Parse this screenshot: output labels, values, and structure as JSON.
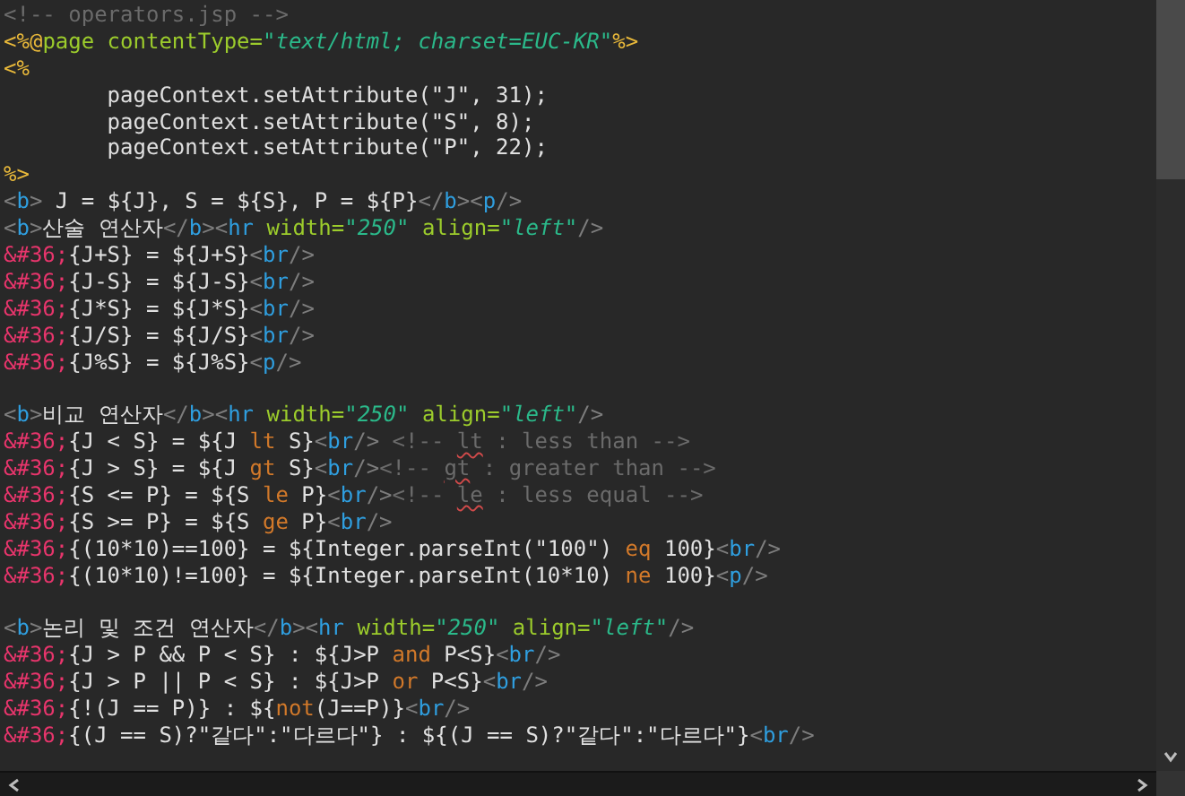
{
  "editor": {
    "lines": [
      {
        "kind": "code",
        "tokens": [
          {
            "kind": "comment",
            "text": "<!-- operators.jsp -->"
          }
        ]
      },
      {
        "kind": "code",
        "tokens": [
          {
            "kind": "directive",
            "text": "<%@"
          },
          {
            "kind": "attr",
            "text": "page contentType="
          },
          {
            "kind": "string",
            "text": "\"text/html; charset=EUC-KR\""
          },
          {
            "kind": "directive",
            "text": "%>"
          }
        ]
      },
      {
        "kind": "code",
        "tokens": [
          {
            "kind": "directive",
            "text": "<%"
          }
        ]
      },
      {
        "kind": "code",
        "tokens": [
          {
            "kind": "text",
            "text": "        pageContext.setAttribute(\"J\", 31);"
          }
        ]
      },
      {
        "kind": "code",
        "tokens": [
          {
            "kind": "text",
            "text": "        pageContext.setAttribute(\"S\", 8);"
          }
        ]
      },
      {
        "kind": "code",
        "tokens": [
          {
            "kind": "text",
            "text": "        pageContext.setAttribute(\"P\", 22);"
          }
        ]
      },
      {
        "kind": "code",
        "tokens": [
          {
            "kind": "directive",
            "text": "%>"
          }
        ]
      },
      {
        "kind": "code",
        "tokens": [
          {
            "kind": "punct",
            "text": "<"
          },
          {
            "kind": "tag",
            "text": "b"
          },
          {
            "kind": "punct",
            "text": ">"
          },
          {
            "kind": "text",
            "text": " J = ${J}, S = ${S}, P = ${P}"
          },
          {
            "kind": "punct",
            "text": "</"
          },
          {
            "kind": "tag",
            "text": "b"
          },
          {
            "kind": "punct",
            "text": "><"
          },
          {
            "kind": "tag",
            "text": "p"
          },
          {
            "kind": "punct",
            "text": "/>"
          }
        ]
      },
      {
        "kind": "code",
        "tokens": [
          {
            "kind": "punct",
            "text": "<"
          },
          {
            "kind": "tag",
            "text": "b"
          },
          {
            "kind": "punct",
            "text": ">"
          },
          {
            "kind": "text",
            "text": "산술 연산자"
          },
          {
            "kind": "punct",
            "text": "</"
          },
          {
            "kind": "tag",
            "text": "b"
          },
          {
            "kind": "punct",
            "text": "><"
          },
          {
            "kind": "tag",
            "text": "hr"
          },
          {
            "kind": "attr",
            "text": " width="
          },
          {
            "kind": "string",
            "text": "\"250\""
          },
          {
            "kind": "attr",
            "text": " align="
          },
          {
            "kind": "string",
            "text": "\"left\""
          },
          {
            "kind": "punct",
            "text": "/>"
          }
        ]
      },
      {
        "kind": "code",
        "tokens": [
          {
            "kind": "entity",
            "text": "&#36;"
          },
          {
            "kind": "text",
            "text": "{J+S} = ${J+S}"
          },
          {
            "kind": "punct",
            "text": "<"
          },
          {
            "kind": "tag",
            "text": "br"
          },
          {
            "kind": "punct",
            "text": "/>"
          }
        ]
      },
      {
        "kind": "code",
        "tokens": [
          {
            "kind": "entity",
            "text": "&#36;"
          },
          {
            "kind": "text",
            "text": "{J-S} = ${J-S}"
          },
          {
            "kind": "punct",
            "text": "<"
          },
          {
            "kind": "tag",
            "text": "br"
          },
          {
            "kind": "punct",
            "text": "/>"
          }
        ]
      },
      {
        "kind": "code",
        "tokens": [
          {
            "kind": "entity",
            "text": "&#36;"
          },
          {
            "kind": "text",
            "text": "{J*S} = ${J*S}"
          },
          {
            "kind": "punct",
            "text": "<"
          },
          {
            "kind": "tag",
            "text": "br"
          },
          {
            "kind": "punct",
            "text": "/>"
          }
        ]
      },
      {
        "kind": "code",
        "tokens": [
          {
            "kind": "entity",
            "text": "&#36;"
          },
          {
            "kind": "text",
            "text": "{J/S} = ${J/S}"
          },
          {
            "kind": "punct",
            "text": "<"
          },
          {
            "kind": "tag",
            "text": "br"
          },
          {
            "kind": "punct",
            "text": "/>"
          }
        ]
      },
      {
        "kind": "code",
        "tokens": [
          {
            "kind": "entity",
            "text": "&#36;"
          },
          {
            "kind": "text",
            "text": "{J%S} = ${J%S}"
          },
          {
            "kind": "punct",
            "text": "<"
          },
          {
            "kind": "tag",
            "text": "p"
          },
          {
            "kind": "punct",
            "text": "/>"
          }
        ]
      },
      {
        "kind": "blank"
      },
      {
        "kind": "code",
        "tokens": [
          {
            "kind": "punct",
            "text": "<"
          },
          {
            "kind": "tag",
            "text": "b"
          },
          {
            "kind": "punct",
            "text": ">"
          },
          {
            "kind": "text",
            "text": "비교 연산자"
          },
          {
            "kind": "punct",
            "text": "</"
          },
          {
            "kind": "tag",
            "text": "b"
          },
          {
            "kind": "punct",
            "text": "><"
          },
          {
            "kind": "tag",
            "text": "hr"
          },
          {
            "kind": "attr",
            "text": " width="
          },
          {
            "kind": "string",
            "text": "\"250\""
          },
          {
            "kind": "attr",
            "text": " align="
          },
          {
            "kind": "string",
            "text": "\"left\""
          },
          {
            "kind": "punct",
            "text": "/>"
          }
        ]
      },
      {
        "kind": "code",
        "tokens": [
          {
            "kind": "entity",
            "text": "&#36;"
          },
          {
            "kind": "text",
            "text": "{J < S} = ${J "
          },
          {
            "kind": "keyword",
            "text": "lt"
          },
          {
            "kind": "text",
            "text": " S}"
          },
          {
            "kind": "punct",
            "text": "<"
          },
          {
            "kind": "tag",
            "text": "br"
          },
          {
            "kind": "punct",
            "text": "/>"
          },
          {
            "kind": "comment",
            "text": " <!-- "
          },
          {
            "kind": "misspelled",
            "text": "lt"
          },
          {
            "kind": "comment",
            "text": " : less than -->"
          }
        ]
      },
      {
        "kind": "code",
        "tokens": [
          {
            "kind": "entity",
            "text": "&#36;"
          },
          {
            "kind": "text",
            "text": "{J > S} = ${J "
          },
          {
            "kind": "keyword",
            "text": "gt"
          },
          {
            "kind": "text",
            "text": " S}"
          },
          {
            "kind": "punct",
            "text": "<"
          },
          {
            "kind": "tag",
            "text": "br"
          },
          {
            "kind": "punct",
            "text": "/>"
          },
          {
            "kind": "comment",
            "text": "<!-- "
          },
          {
            "kind": "misspelled",
            "text": "gt"
          },
          {
            "kind": "comment",
            "text": " : greater than -->"
          }
        ]
      },
      {
        "kind": "code",
        "tokens": [
          {
            "kind": "entity",
            "text": "&#36;"
          },
          {
            "kind": "text",
            "text": "{S <= P} = ${S "
          },
          {
            "kind": "keyword",
            "text": "le"
          },
          {
            "kind": "text",
            "text": " P}"
          },
          {
            "kind": "punct",
            "text": "<"
          },
          {
            "kind": "tag",
            "text": "br"
          },
          {
            "kind": "punct",
            "text": "/>"
          },
          {
            "kind": "comment",
            "text": "<!-- "
          },
          {
            "kind": "misspelled",
            "text": "le"
          },
          {
            "kind": "comment",
            "text": " : less equal -->"
          }
        ]
      },
      {
        "kind": "code",
        "tokens": [
          {
            "kind": "entity",
            "text": "&#36;"
          },
          {
            "kind": "text",
            "text": "{S >= P} = ${S "
          },
          {
            "kind": "keyword",
            "text": "ge"
          },
          {
            "kind": "text",
            "text": " P}"
          },
          {
            "kind": "punct",
            "text": "<"
          },
          {
            "kind": "tag",
            "text": "br"
          },
          {
            "kind": "punct",
            "text": "/>"
          }
        ]
      },
      {
        "kind": "code",
        "tokens": [
          {
            "kind": "entity",
            "text": "&#36;"
          },
          {
            "kind": "text",
            "text": "{(10*10)==100} = ${Integer.parseInt(\"100\") "
          },
          {
            "kind": "keyword",
            "text": "eq"
          },
          {
            "kind": "text",
            "text": " 100}"
          },
          {
            "kind": "punct",
            "text": "<"
          },
          {
            "kind": "tag",
            "text": "br"
          },
          {
            "kind": "punct",
            "text": "/>"
          }
        ]
      },
      {
        "kind": "code",
        "tokens": [
          {
            "kind": "entity",
            "text": "&#36;"
          },
          {
            "kind": "text",
            "text": "{(10*10)!=100} = ${Integer.parseInt(10*10) "
          },
          {
            "kind": "keyword",
            "text": "ne"
          },
          {
            "kind": "text",
            "text": " 100}"
          },
          {
            "kind": "punct",
            "text": "<"
          },
          {
            "kind": "tag",
            "text": "p"
          },
          {
            "kind": "punct",
            "text": "/>"
          }
        ]
      },
      {
        "kind": "blank"
      },
      {
        "kind": "code",
        "tokens": [
          {
            "kind": "punct",
            "text": "<"
          },
          {
            "kind": "tag",
            "text": "b"
          },
          {
            "kind": "punct",
            "text": ">"
          },
          {
            "kind": "text",
            "text": "논리 및 조건 연산자"
          },
          {
            "kind": "punct",
            "text": "</"
          },
          {
            "kind": "tag",
            "text": "b"
          },
          {
            "kind": "punct",
            "text": "><"
          },
          {
            "kind": "tag",
            "text": "hr"
          },
          {
            "kind": "attr",
            "text": " width="
          },
          {
            "kind": "string",
            "text": "\"250\""
          },
          {
            "kind": "attr",
            "text": " align="
          },
          {
            "kind": "string",
            "text": "\"left\""
          },
          {
            "kind": "punct",
            "text": "/>"
          }
        ]
      },
      {
        "kind": "code",
        "tokens": [
          {
            "kind": "entity",
            "text": "&#36;"
          },
          {
            "kind": "text",
            "text": "{J > P && P < S} : ${J>P "
          },
          {
            "kind": "keyword",
            "text": "and"
          },
          {
            "kind": "text",
            "text": " P<S}"
          },
          {
            "kind": "punct",
            "text": "<"
          },
          {
            "kind": "tag",
            "text": "br"
          },
          {
            "kind": "punct",
            "text": "/>"
          }
        ]
      },
      {
        "kind": "code",
        "tokens": [
          {
            "kind": "entity",
            "text": "&#36;"
          },
          {
            "kind": "text",
            "text": "{J > P || P < S} : ${J>P "
          },
          {
            "kind": "keyword",
            "text": "or"
          },
          {
            "kind": "text",
            "text": " P<S}"
          },
          {
            "kind": "punct",
            "text": "<"
          },
          {
            "kind": "tag",
            "text": "br"
          },
          {
            "kind": "punct",
            "text": "/>"
          }
        ]
      },
      {
        "kind": "code",
        "tokens": [
          {
            "kind": "entity",
            "text": "&#36;"
          },
          {
            "kind": "text",
            "text": "{!(J == P)} : ${"
          },
          {
            "kind": "keyword",
            "text": "not"
          },
          {
            "kind": "text",
            "text": "(J==P)}"
          },
          {
            "kind": "punct",
            "text": "<"
          },
          {
            "kind": "tag",
            "text": "br"
          },
          {
            "kind": "punct",
            "text": "/>"
          }
        ]
      },
      {
        "kind": "code",
        "tokens": [
          {
            "kind": "entity",
            "text": "&#36;"
          },
          {
            "kind": "text",
            "text": "{(J == S)?\"같다\":\"다르다\"} : ${(J == S)?\"같다\":\"다르다\"}"
          },
          {
            "kind": "punct",
            "text": "<"
          },
          {
            "kind": "tag",
            "text": "br"
          },
          {
            "kind": "punct",
            "text": "/>"
          }
        ]
      }
    ]
  }
}
